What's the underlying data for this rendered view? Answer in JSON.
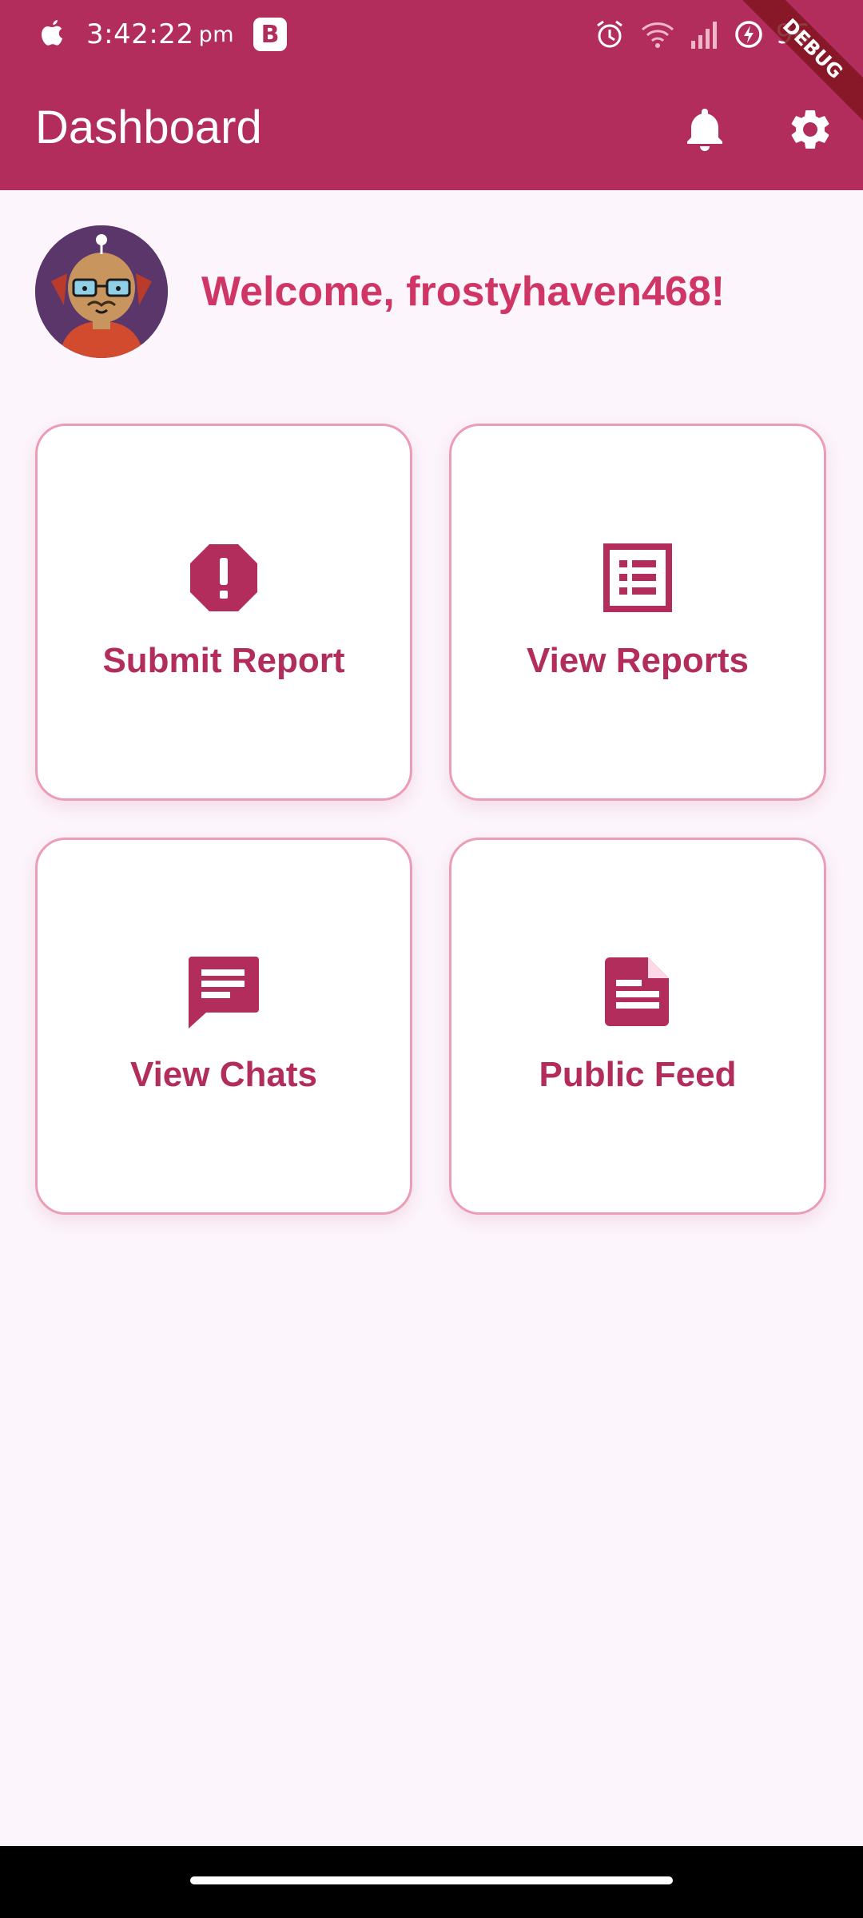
{
  "status_bar": {
    "time": "3:42:22",
    "time_suffix": "pm",
    "app_badge": "B",
    "battery": "96"
  },
  "debug_banner": "DEBUG",
  "app_bar": {
    "title": "Dashboard",
    "actions": [
      "bell-icon",
      "gear-icon"
    ]
  },
  "welcome": {
    "text": "Welcome, frostyhaven468!"
  },
  "tiles": [
    {
      "label": "Submit Report",
      "icon": "report-alert-icon"
    },
    {
      "label": "View Reports",
      "icon": "list-alt-icon"
    },
    {
      "label": "View Chats",
      "icon": "chat-icon"
    },
    {
      "label": "Public Feed",
      "icon": "article-icon"
    }
  ],
  "colors": {
    "primary": "#b22d5c",
    "welcome_text": "#cf3666",
    "card_border": "#eb9db7",
    "background": "#fcf5fb"
  }
}
